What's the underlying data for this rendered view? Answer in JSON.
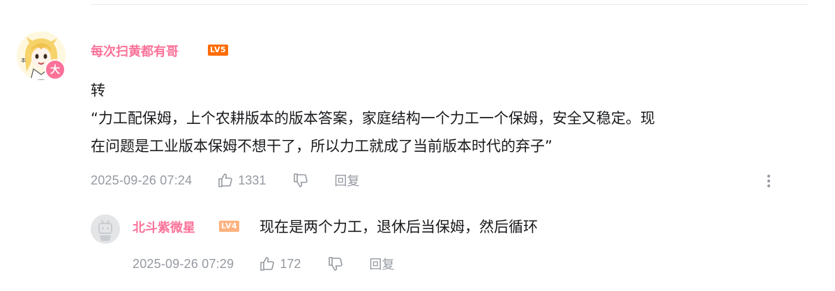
{
  "comment": {
    "username": "每次扫黄都有哥",
    "level_badge": "LV5",
    "vip_badge": "大",
    "text_lines": [
      "转",
      "“力工配保姆，上个农耕版本的版本答案，家庭结构一个力工一个保姆，安全又稳定。现",
      "在问题是工业版本保姆不想干了，所以力工就成了当前版本时代的弃子”"
    ],
    "timestamp": "2025-09-26 07:24",
    "like_count": "1331",
    "reply_label": "回复",
    "icons": {
      "like": "thumbs-up-icon",
      "dislike": "thumbs-down-icon",
      "more": "more-vertical-icon"
    }
  },
  "reply": {
    "username": "北斗紫微星",
    "level_badge": "LV4",
    "text": "现在是两个力工，退休后当保姆，然后循环",
    "timestamp": "2025-09-26 07:29",
    "like_count": "172",
    "reply_label": "回复"
  },
  "colors": {
    "username": "#fb7299",
    "meta_text": "#9499a0",
    "body_text": "#18191c",
    "lv5_badge": "#ff6c00",
    "lv4_badge": "#ffb27f"
  }
}
